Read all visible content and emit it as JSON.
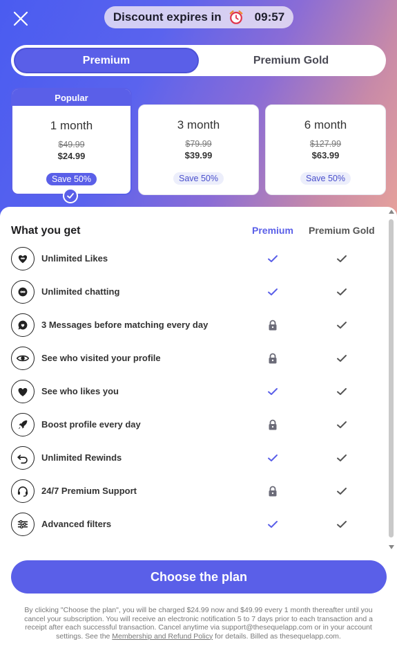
{
  "timer": {
    "label": "Discount expires in",
    "value": "09:57"
  },
  "tabs": [
    {
      "label": "Premium",
      "selected": true
    },
    {
      "label": "Premium Gold",
      "selected": false
    }
  ],
  "plans": [
    {
      "badge": "Popular",
      "duration": "1 month",
      "old_price": "$49.99",
      "price": "$24.99",
      "save": "Save 50%",
      "selected": true
    },
    {
      "duration": "3 month",
      "old_price": "$79.99",
      "price": "$39.99",
      "save": "Save 50%",
      "selected": false
    },
    {
      "duration": "6 month",
      "old_price": "$127.99",
      "price": "$63.99",
      "save": "Save 50%",
      "selected": false
    }
  ],
  "features_table": {
    "title": "What you get",
    "col_premium": "Premium",
    "col_gold": "Premium Gold",
    "rows": [
      {
        "label": "Unlimited Likes",
        "icon": "heart-infinity-icon",
        "premium": "check",
        "gold": "check"
      },
      {
        "label": "Unlimited chatting",
        "icon": "chat-infinity-icon",
        "premium": "check",
        "gold": "check"
      },
      {
        "label": "3 Messages before matching every day",
        "icon": "chat-heart-icon",
        "premium": "lock",
        "gold": "check"
      },
      {
        "label": "See who visited your profile",
        "icon": "eye-icon",
        "premium": "lock",
        "gold": "check"
      },
      {
        "label": "See who likes you",
        "icon": "heart-icon",
        "premium": "check",
        "gold": "check"
      },
      {
        "label": "Boost profile every day",
        "icon": "rocket-icon",
        "premium": "lock",
        "gold": "check"
      },
      {
        "label": "Unlimited Rewinds",
        "icon": "rewind-icon",
        "premium": "check",
        "gold": "check"
      },
      {
        "label": "24/7 Premium Support",
        "icon": "headset-icon",
        "premium": "lock",
        "gold": "check"
      },
      {
        "label": "Advanced filters",
        "icon": "filters-icon",
        "premium": "check",
        "gold": "check"
      }
    ]
  },
  "cta": {
    "label": "Choose the plan"
  },
  "legal": {
    "text_before": "By clicking \"Choose the plan\", you will be charged $24.99 now and $49.99 every 1 month thereafter until you cancel your subscription. You will receive an electronic notification 5 to 7 days prior to each transaction and a receipt after each successful transaction. Cancel anytime via support@thesequelapp.com or in your account settings. See the ",
    "link": "Membership and Refund Policy",
    "text_after": " for details. Billed as thesequelapp.com."
  },
  "colors": {
    "accent": "#5a5fe8",
    "lock": "#6b6b78",
    "check_gold": "#555555"
  }
}
